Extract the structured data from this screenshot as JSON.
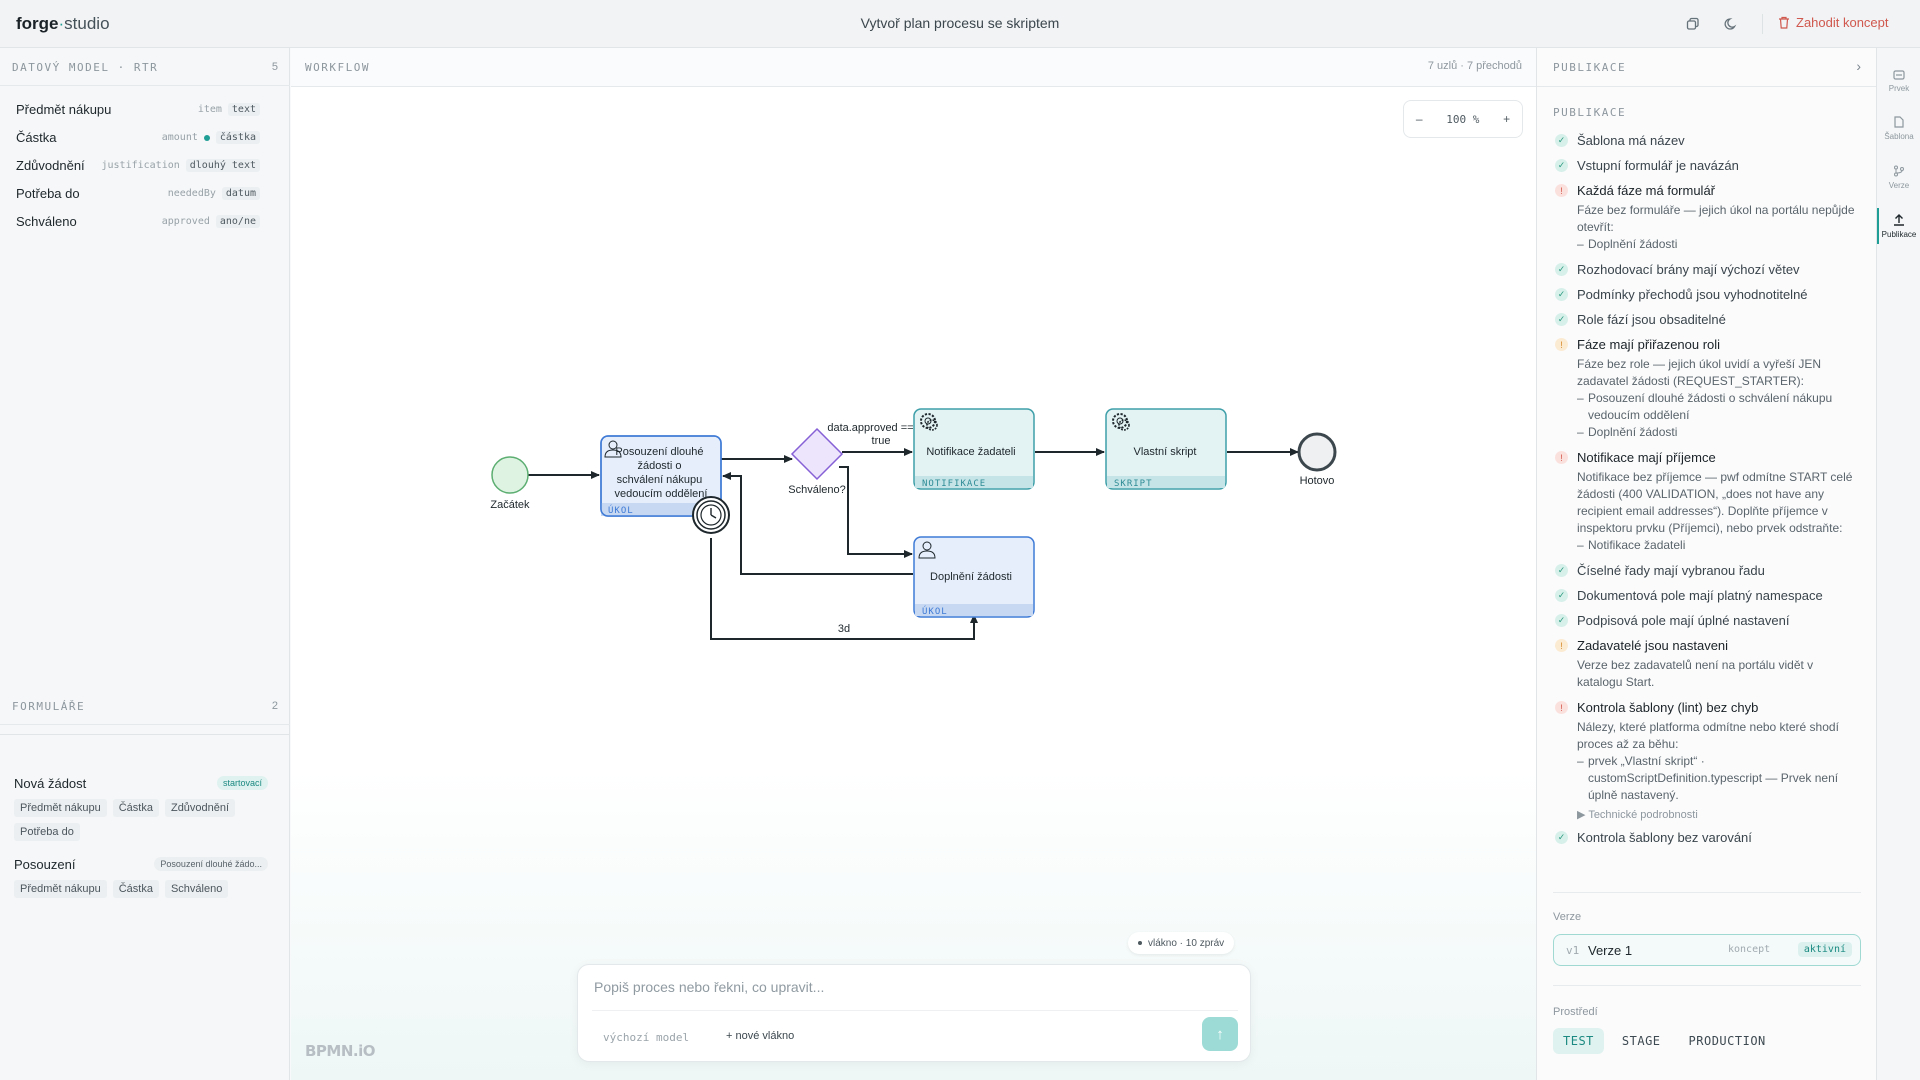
{
  "topbar": {
    "logo_bold": "forge",
    "logo_dot": "·",
    "logo_light": "studio",
    "title": "Vytvoř plan procesu se skriptem",
    "discard_label": "Zahodit koncept"
  },
  "data_model": {
    "title": "DATOVÝ MODEL · RTR",
    "count": "5",
    "fields": [
      {
        "label": "Předmět nákupu",
        "key": "item",
        "type": "text",
        "required": false
      },
      {
        "label": "Částka",
        "key": "amount",
        "type": "částka",
        "required": true
      },
      {
        "label": "Zdůvodnění",
        "key": "justification",
        "type": "dlouhý text",
        "required": false
      },
      {
        "label": "Potřeba do",
        "key": "neededBy",
        "type": "datum",
        "required": false
      },
      {
        "label": "Schváleno",
        "key": "approved",
        "type": "ano/ne",
        "required": false
      }
    ]
  },
  "forms": {
    "title": "FORMULÁŘE",
    "count": "2",
    "items": [
      {
        "title": "Nová žádost",
        "badge": "startovací",
        "chips": [
          "Předmět nákupu",
          "Částka",
          "Zdůvodnění",
          "Potřeba do"
        ]
      },
      {
        "title": "Posouzení",
        "badge": "Posouzení dlouhé žádo...",
        "chips": [
          "Předmět nákupu",
          "Částka",
          "Schváleno"
        ]
      }
    ]
  },
  "workflow": {
    "title": "WORKFLOW",
    "stats": "7 uzlů · 7 přechodů",
    "zoom": {
      "minus": "–",
      "value": "100 %",
      "plus": "+"
    },
    "nodes": {
      "start_label": "Začátek",
      "review_lines": [
        "Posouzení dlouhé",
        "žádosti o",
        "schválení nákupu",
        "vedoucím oddělení"
      ],
      "review_tag": "ÚKOL",
      "gateway_label": "Schváleno?",
      "condition_lines": [
        "data.approved ==",
        "true"
      ],
      "notify_label": "Notifikace žadateli",
      "notify_tag": "NOTIFIKACE",
      "script_label": "Vlastní skript",
      "script_tag": "SKRIPT",
      "end_label": "Hotovo",
      "complete_label": "Doplnění žádosti",
      "complete_tag": "ÚKOL",
      "timer_label": "3d"
    },
    "thread_pill": "vlákno · 10 zpráv",
    "prompt_placeholder": "Popiš proces nebo řekni, co upravit...",
    "model": "výchozí model",
    "new_thread": "+ nové vlákno",
    "send_icon": "↑",
    "watermark": "BPMN.iO"
  },
  "publish": {
    "header": "PUBLIKACE",
    "subheader": "PUBLIKACE",
    "checks": [
      {
        "status": "ok",
        "label": "Šablona má název"
      },
      {
        "status": "ok",
        "label": "Vstupní formulář je navázán"
      },
      {
        "status": "err",
        "label": "Každá fáze má formulář",
        "desc": "Fáze bez formuláře — jejich úkol na portálu nepůjde otevřít:",
        "items": [
          "Doplnění žádosti"
        ]
      },
      {
        "status": "ok",
        "label": "Rozhodovací brány mají výchozí větev"
      },
      {
        "status": "ok",
        "label": "Podmínky přechodů jsou vyhodnotitelné"
      },
      {
        "status": "ok",
        "label": "Role fází jsou obsaditelné"
      },
      {
        "status": "warn",
        "label": "Fáze mají přiřazenou roli",
        "desc": "Fáze bez role — jejich úkol uvidí a vyřeší JEN zadavatel žádosti (REQUEST_STARTER):",
        "items": [
          "Posouzení dlouhé žádosti o schválení nákupu vedoucím oddělení",
          "Doplnění žádosti"
        ]
      },
      {
        "status": "err",
        "label": "Notifikace mají příjemce",
        "desc": "Notifikace bez příjemce — pwf odmítne START celé žádosti (400 VALIDATION, „does not have any recipient email addresses“). Doplňte příjemce v inspektoru prvku (Příjemci), nebo prvek odstraňte:",
        "items": [
          "Notifikace žadateli"
        ]
      },
      {
        "status": "ok",
        "label": "Číselné řady mají vybranou řadu"
      },
      {
        "status": "ok",
        "label": "Dokumentová pole mají platný namespace"
      },
      {
        "status": "ok",
        "label": "Podpisová pole mají úplné nastavení"
      },
      {
        "status": "warn",
        "label": "Zadavatelé jsou nastaveni",
        "desc": "Verze bez zadavatelů není na portálu vidět v katalogu Start."
      },
      {
        "status": "err",
        "label": "Kontrola šablony (lint) bez chyb",
        "desc": "Nálezy, které platforma odmítne nebo které shodí proces až za běhu:",
        "items": [
          "prvek „Vlastní skript“ · customScriptDefinition.typescript — Prvek není úplně nastavený."
        ],
        "tech": "▶ Technické podrobnosti"
      },
      {
        "status": "ok",
        "label": "Kontrola šablony bez varování"
      }
    ],
    "versions_title": "Verze",
    "version": {
      "num": "v1",
      "name": "Verze 1",
      "state": "koncept",
      "active": "aktivní"
    },
    "env_title": "Prostředí",
    "envs": [
      "TEST",
      "STAGE",
      "PRODUCTION"
    ]
  },
  "rail": [
    {
      "label": "Prvek",
      "icon": "element-icon"
    },
    {
      "label": "Šablona",
      "icon": "document-icon"
    },
    {
      "label": "Verze",
      "icon": "branch-icon"
    },
    {
      "label": "Publikace",
      "icon": "upload-icon"
    }
  ],
  "colors": {
    "accent": "#1f9e95",
    "error": "#d5564a",
    "warning": "#d68a2a",
    "ok": "#2c9a7f",
    "task_fill": "#e6eefb",
    "service_fill": "#e3f3f4"
  }
}
